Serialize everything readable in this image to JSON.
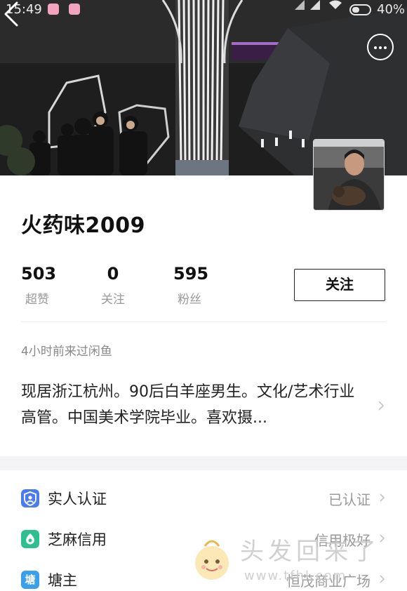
{
  "status_bar": {
    "time": "15:49",
    "battery": "40%",
    "icons": [
      "app-notification-icon",
      "app-notification-icon",
      "signal-icon",
      "signal-icon",
      "wifi-icon",
      "battery-icon"
    ]
  },
  "header": {
    "back_icon": "chevron-left-icon",
    "more_icon": "more-horizontal-icon"
  },
  "profile": {
    "username": "火药味2009",
    "stats": [
      {
        "value": "503",
        "label": "超赞"
      },
      {
        "value": "0",
        "label": "关注"
      },
      {
        "value": "595",
        "label": "粉丝"
      }
    ],
    "follow_label": "关注",
    "last_seen": "4小时前来过闲鱼",
    "bio": "现居浙江杭州。90后白羊座男生。文化/艺术行业高管。中国美术学院毕业。喜欢摄..."
  },
  "rows": [
    {
      "label": "实人认证",
      "value": "已认证",
      "icon": "verified-person-icon",
      "color": "#4a7cf0"
    },
    {
      "label": "芝麻信用",
      "value": "信用极好",
      "icon": "sesame-credit-icon",
      "color": "#2fbf8f"
    },
    {
      "label": "塘主",
      "value": "恒茂商业广场",
      "icon": "pond-icon",
      "icon_text": "塘",
      "color": "#3aa0ee"
    }
  ],
  "watermark": {
    "title": "头发回来了",
    "url": "www.tfhl.com"
  }
}
